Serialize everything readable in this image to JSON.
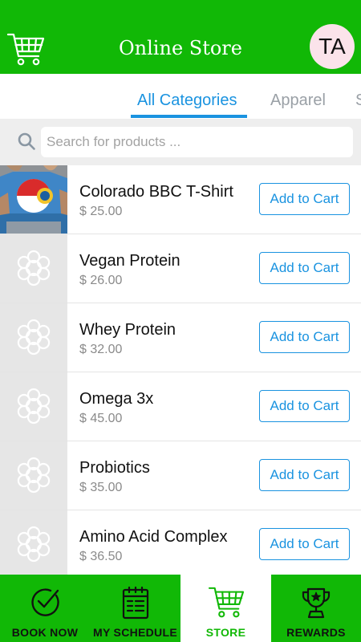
{
  "header": {
    "title": "Online Store",
    "avatar_initials": "TA"
  },
  "tabs": [
    {
      "label": "All Categories",
      "active": true
    },
    {
      "label": "Apparel",
      "active": false
    },
    {
      "label": "S",
      "active": false
    }
  ],
  "search": {
    "placeholder": "Search for products ..."
  },
  "products": [
    {
      "name": "Colorado BBC T-Shirt",
      "price": "$ 25.00",
      "button": "Add to Cart",
      "thumbnail": "photo"
    },
    {
      "name": "Vegan Protein",
      "price": "$ 26.00",
      "button": "Add to Cart",
      "thumbnail": "placeholder"
    },
    {
      "name": "Whey Protein",
      "price": "$ 32.00",
      "button": "Add to Cart",
      "thumbnail": "placeholder"
    },
    {
      "name": "Omega 3x",
      "price": "$ 45.00",
      "button": "Add to Cart",
      "thumbnail": "placeholder"
    },
    {
      "name": "Probiotics",
      "price": "$ 35.00",
      "button": "Add to Cart",
      "thumbnail": "placeholder"
    },
    {
      "name": "Amino Acid Complex",
      "price": "$ 36.50",
      "button": "Add to Cart",
      "thumbnail": "placeholder"
    }
  ],
  "bottom_nav": [
    {
      "label": "BOOK NOW",
      "icon": "check-circle-icon",
      "active": false
    },
    {
      "label": "MY SCHEDULE",
      "icon": "calendar-icon",
      "active": false
    },
    {
      "label": "STORE",
      "icon": "cart-icon",
      "active": true
    },
    {
      "label": "REWARDS",
      "icon": "trophy-icon",
      "active": false
    }
  ],
  "colors": {
    "brand_green": "#11b806",
    "accent_blue": "#1a93e0",
    "avatar_bg": "#fbe3ea"
  }
}
